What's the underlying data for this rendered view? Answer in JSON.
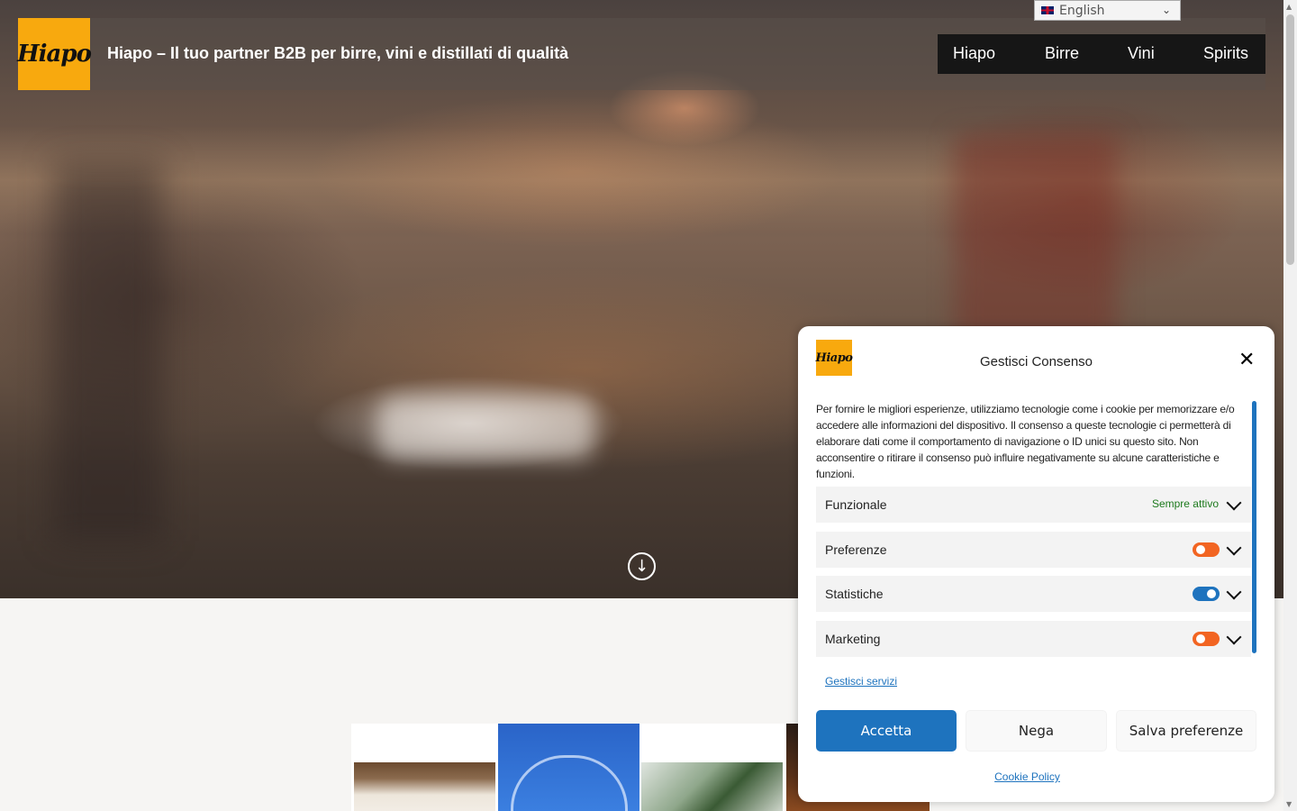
{
  "language_selector": {
    "selected": "English"
  },
  "header": {
    "logo_text": "Hiapo",
    "site_title": "Hiapo – Il tuo partner B2B per birre, vini e distillati di qualità"
  },
  "nav": {
    "items": [
      "Hiapo",
      "Birre",
      "Vini",
      "Spirits"
    ]
  },
  "hero": {
    "scroll_icon": "arrow-down-circle-icon"
  },
  "cookie_banner": {
    "logo_text": "Hiapo",
    "title": "Gestisci Consenso",
    "description": "Per fornire le migliori esperienze, utilizziamo tecnologie come i cookie per memorizzare e/o accedere alle informazioni del dispositivo. Il consenso a queste tecnologie ci permetterà di elaborare dati come il comportamento di navigazione o ID unici su questo sito. Non acconsentire o ritirare il consenso può influire negativamente su alcune caratteristiche e funzioni.",
    "categories": [
      {
        "label": "Funzionale",
        "status": "Sempre attivo"
      },
      {
        "label": "Preferenze",
        "enabled": false
      },
      {
        "label": "Statistiche",
        "enabled": true
      },
      {
        "label": "Marketing",
        "enabled": false
      }
    ],
    "manage_services": "Gestisci servizi",
    "buttons": {
      "accept": "Accetta",
      "deny": "Nega",
      "save": "Salva preferenze"
    },
    "cookie_policy": "Cookie Policy"
  },
  "colors": {
    "brand_orange": "#f8a90e",
    "accent_blue": "#1e73be",
    "toggle_off": "#f26522",
    "always_active_green": "#1d7a1d",
    "nav_background": "#161616"
  }
}
